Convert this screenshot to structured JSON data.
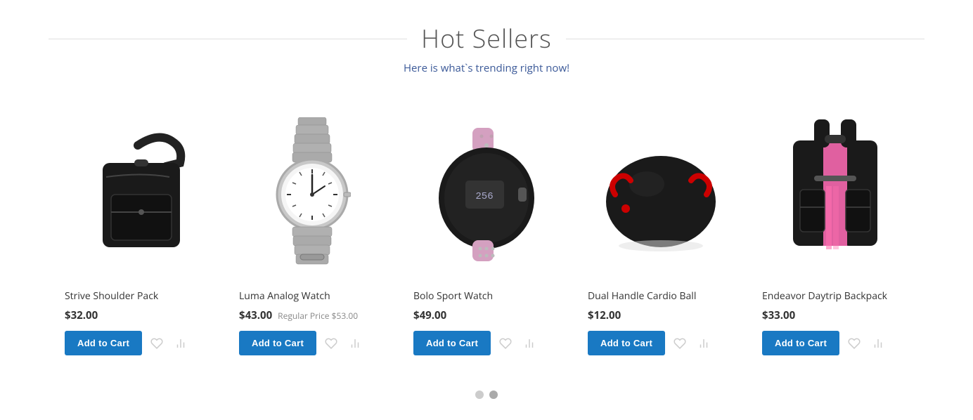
{
  "header": {
    "title": "Hot Sellers",
    "subtitle": "Here is what`s trending right now!"
  },
  "products": [
    {
      "id": "strive-shoulder-pack",
      "name": "Strive Shoulder Pack",
      "price": "$32.00",
      "regular_price": null,
      "image_type": "shoulder-bag",
      "add_to_cart_label": "Add to Cart"
    },
    {
      "id": "luma-analog-watch",
      "name": "Luma Analog Watch",
      "price": "$43.00",
      "regular_price": "Regular Price $53.00",
      "image_type": "analog-watch",
      "add_to_cart_label": "Add to Cart"
    },
    {
      "id": "bolo-sport-watch",
      "name": "Bolo Sport Watch",
      "price": "$49.00",
      "regular_price": null,
      "image_type": "sport-watch",
      "add_to_cart_label": "Add to Cart"
    },
    {
      "id": "dual-handle-cardio-ball",
      "name": "Dual Handle Cardio Ball",
      "price": "$12.00",
      "regular_price": null,
      "image_type": "cardio-ball",
      "add_to_cart_label": "Add to Cart"
    },
    {
      "id": "endeavor-daytrip-backpack",
      "name": "Endeavor Daytrip Backpack",
      "price": "$33.00",
      "regular_price": null,
      "image_type": "backpack",
      "add_to_cart_label": "Add to Cart"
    }
  ],
  "carousel": {
    "dots": [
      {
        "index": 0,
        "active": false
      },
      {
        "index": 1,
        "active": true
      }
    ]
  }
}
